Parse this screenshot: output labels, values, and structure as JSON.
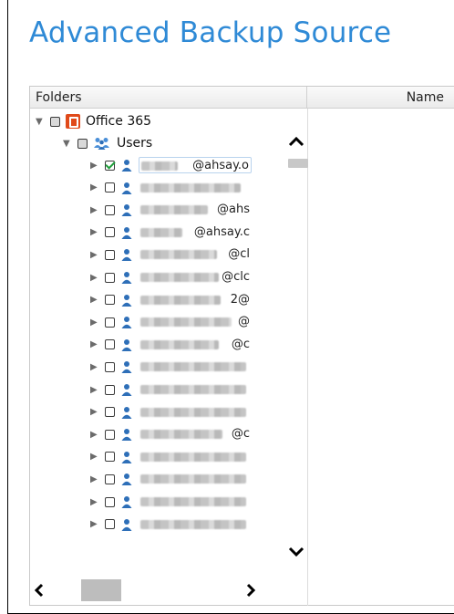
{
  "title": "Advanced Backup Source",
  "columns": {
    "folders": "Folders",
    "name": "Name"
  },
  "tree": {
    "root": {
      "label": "Office 365",
      "state": "partial",
      "expanded": true
    },
    "group": {
      "label": "Users",
      "state": "partial",
      "expanded": true
    },
    "users": [
      {
        "text": "@ahsay.o",
        "checked": true,
        "selected": true
      },
      {
        "text": "",
        "checked": false
      },
      {
        "text": "@ahs",
        "checked": false
      },
      {
        "text": "@ahsay.c",
        "checked": false
      },
      {
        "text": "@cl",
        "checked": false
      },
      {
        "text": "@clc",
        "checked": false
      },
      {
        "text": "2@",
        "checked": false
      },
      {
        "text": "@",
        "checked": false
      },
      {
        "text": "@c",
        "checked": false
      },
      {
        "text": "",
        "checked": false
      },
      {
        "text": "",
        "checked": false
      },
      {
        "text": "",
        "checked": false
      },
      {
        "text": "@c",
        "checked": false
      },
      {
        "text": "",
        "checked": false
      },
      {
        "text": "",
        "checked": false
      },
      {
        "text": "",
        "checked": false
      },
      {
        "text": "",
        "checked": false
      }
    ]
  },
  "scrollbars": {
    "up": "^",
    "down": "⌄",
    "left": "❮",
    "right": "❯"
  },
  "colors": {
    "title": "#2f8ad6",
    "person_icon": "#2e6fb8",
    "check": "#1e9e3a",
    "office_logo": "#e04a1a"
  }
}
